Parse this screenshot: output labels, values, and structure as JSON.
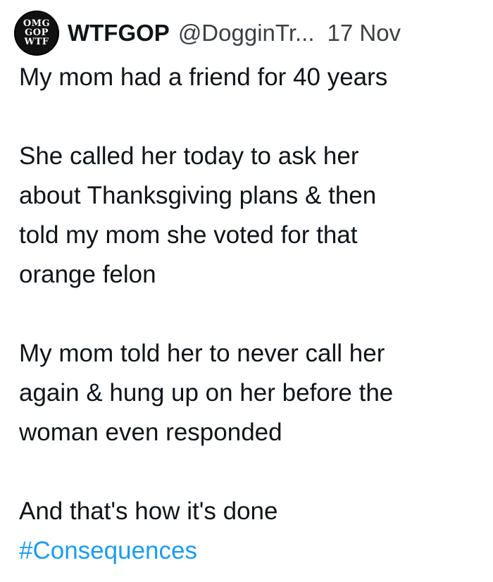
{
  "tweet": {
    "avatar": {
      "line1": "OMG",
      "line2": "GOP",
      "line3": "WTF"
    },
    "display_name": "WTFGOP",
    "handle": "@DogginTr...",
    "date": "17 Nov",
    "paragraphs": [
      {
        "lines": [
          "My mom had a friend for 40 years"
        ]
      },
      {
        "lines": [
          "She called her today to ask her",
          "about Thanksgiving plans & then",
          "told my mom she voted for that",
          "orange felon"
        ]
      },
      {
        "lines": [
          "My mom told her to never call her",
          "again & hung up on her before the",
          "woman even responded"
        ]
      },
      {
        "lines": [
          "And that's how it's done"
        ]
      }
    ],
    "hashtag": "#Consequences"
  },
  "colors": {
    "text": "#0f1419",
    "secondary": "#3b3f44",
    "link": "#1d9bf0",
    "background": "#ffffff"
  }
}
